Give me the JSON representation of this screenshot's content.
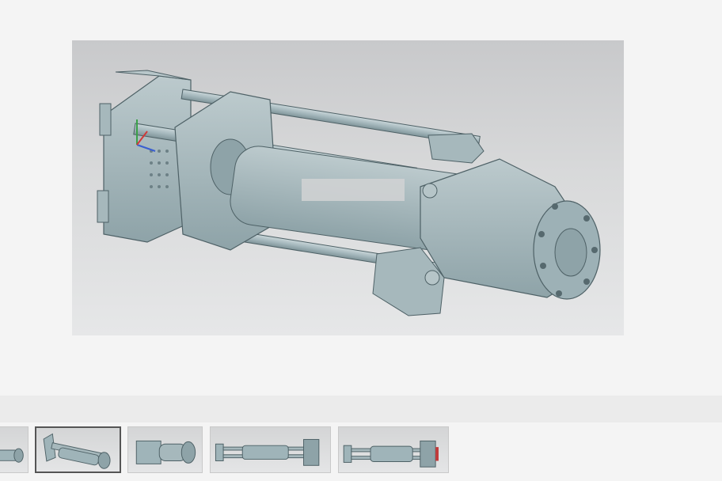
{
  "viewer": {
    "main_image_icon": "cad-assembly-render-icon",
    "selected_index": 1
  },
  "thumbnails": [
    {
      "icon": "cad-view-partial-icon",
      "selected": false
    },
    {
      "icon": "cad-view-isometric-icon",
      "selected": true
    },
    {
      "icon": "cad-view-rear-icon",
      "selected": false
    },
    {
      "icon": "cad-view-side-icon",
      "selected": false
    },
    {
      "icon": "cad-view-top-icon",
      "selected": false
    }
  ],
  "colors": {
    "background": "#f4f4f4",
    "strip": "#ebebeb",
    "model": "#9fb4b9",
    "selected_border": "#555555"
  }
}
